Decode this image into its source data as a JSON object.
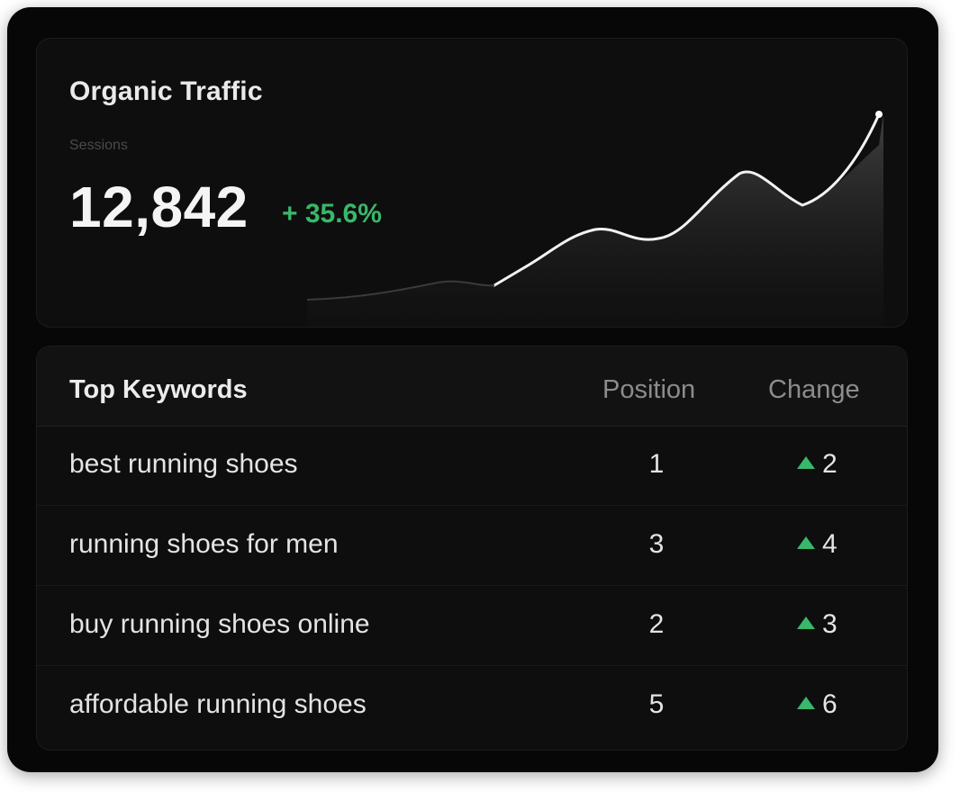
{
  "traffic": {
    "title": "Organic Traffic",
    "sublabel": "Sessions",
    "value": "12,842",
    "change": "+ 35.6%"
  },
  "keywords": {
    "headers": {
      "title": "Top Keywords",
      "position": "Position",
      "change": "Change"
    },
    "rows": [
      {
        "keyword": "best running shoes",
        "position": "1",
        "change": "2"
      },
      {
        "keyword": "running shoes for men",
        "position": "3",
        "change": "4"
      },
      {
        "keyword": "buy running shoes online",
        "position": "2",
        "change": "3"
      },
      {
        "keyword": "affordable running shoes",
        "position": "5",
        "change": "6"
      }
    ]
  },
  "icons": {
    "up_arrow": "triangle-up-icon"
  },
  "colors": {
    "positive": "#38b86a",
    "background": "#070707",
    "panel": "#0e0e0e"
  }
}
